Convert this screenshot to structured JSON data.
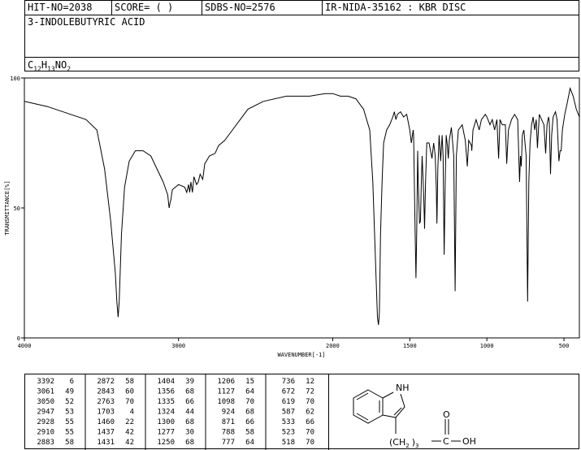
{
  "header": {
    "hit_no": "HIT-NO=2038",
    "score": "SCORE=  (  )",
    "sdbs_no": "SDBS-NO=2576",
    "ir_nida": "IR-NIDA-35162 : KBR DISC",
    "compound_name": "3-INDOLEBUTYRIC ACID",
    "formula_parts": [
      "C",
      "12",
      "H",
      "13",
      "NO",
      "2"
    ]
  },
  "chart_data": {
    "type": "line",
    "xlabel": "WAVENUMBER[-1]",
    "ylabel": "TRANSMITTANCE[%]",
    "xlim": [
      4000,
      400
    ],
    "ylim": [
      0,
      100
    ],
    "x_ticks": [
      4000,
      3000,
      2000,
      1500,
      1000,
      500
    ],
    "y_ticks": [
      0,
      50,
      100
    ],
    "series": [
      {
        "points": [
          [
            4000,
            91
          ],
          [
            3850,
            89
          ],
          [
            3700,
            86
          ],
          [
            3600,
            84
          ],
          [
            3530,
            80
          ],
          [
            3480,
            65
          ],
          [
            3440,
            45
          ],
          [
            3410,
            25
          ],
          [
            3400,
            14
          ],
          [
            3392,
            8
          ],
          [
            3385,
            14
          ],
          [
            3370,
            40
          ],
          [
            3350,
            58
          ],
          [
            3320,
            68
          ],
          [
            3280,
            72
          ],
          [
            3230,
            72
          ],
          [
            3180,
            70
          ],
          [
            3140,
            65
          ],
          [
            3100,
            60
          ],
          [
            3070,
            55
          ],
          [
            3061,
            50
          ],
          [
            3055,
            52
          ],
          [
            3050,
            53
          ],
          [
            3040,
            57
          ],
          [
            3020,
            58
          ],
          [
            3000,
            59
          ],
          [
            2960,
            58
          ],
          [
            2947,
            56
          ],
          [
            2935,
            59
          ],
          [
            2928,
            56
          ],
          [
            2920,
            60
          ],
          [
            2910,
            56
          ],
          [
            2900,
            62
          ],
          [
            2883,
            59
          ],
          [
            2872,
            60
          ],
          [
            2860,
            63
          ],
          [
            2843,
            61
          ],
          [
            2830,
            67
          ],
          [
            2800,
            70
          ],
          [
            2763,
            71
          ],
          [
            2740,
            74
          ],
          [
            2700,
            76
          ],
          [
            2650,
            80
          ],
          [
            2600,
            84
          ],
          [
            2550,
            88
          ],
          [
            2450,
            91
          ],
          [
            2300,
            93
          ],
          [
            2150,
            93
          ],
          [
            2050,
            94
          ],
          [
            2000,
            94
          ],
          [
            1950,
            93
          ],
          [
            1900,
            93
          ],
          [
            1850,
            92
          ],
          [
            1800,
            88
          ],
          [
            1760,
            80
          ],
          [
            1740,
            60
          ],
          [
            1720,
            25
          ],
          [
            1710,
            8
          ],
          [
            1703,
            5
          ],
          [
            1697,
            10
          ],
          [
            1690,
            40
          ],
          [
            1680,
            60
          ],
          [
            1670,
            75
          ],
          [
            1650,
            80
          ],
          [
            1630,
            82
          ],
          [
            1610,
            85
          ],
          [
            1600,
            87
          ],
          [
            1590,
            84
          ],
          [
            1580,
            86
          ],
          [
            1560,
            87
          ],
          [
            1540,
            85
          ],
          [
            1520,
            86
          ],
          [
            1500,
            80
          ],
          [
            1490,
            75
          ],
          [
            1478,
            80
          ],
          [
            1475,
            78
          ],
          [
            1465,
            40
          ],
          [
            1460,
            23
          ],
          [
            1455,
            40
          ],
          [
            1449,
            72
          ],
          [
            1445,
            60
          ],
          [
            1437,
            44
          ],
          [
            1431,
            45
          ],
          [
            1425,
            60
          ],
          [
            1420,
            70
          ],
          [
            1410,
            55
          ],
          [
            1404,
            42
          ],
          [
            1398,
            60
          ],
          [
            1390,
            75
          ],
          [
            1375,
            75
          ],
          [
            1356,
            69
          ],
          [
            1345,
            75
          ],
          [
            1335,
            70
          ],
          [
            1328,
            58
          ],
          [
            1324,
            44
          ],
          [
            1318,
            65
          ],
          [
            1310,
            78
          ],
          [
            1300,
            68
          ],
          [
            1290,
            78
          ],
          [
            1284,
            70
          ],
          [
            1277,
            32
          ],
          [
            1270,
            60
          ],
          [
            1264,
            78
          ],
          [
            1256,
            74
          ],
          [
            1250,
            69
          ],
          [
            1244,
            76
          ],
          [
            1230,
            81
          ],
          [
            1215,
            70
          ],
          [
            1206,
            18
          ],
          [
            1198,
            70
          ],
          [
            1185,
            80
          ],
          [
            1160,
            82
          ],
          [
            1140,
            76
          ],
          [
            1127,
            66
          ],
          [
            1118,
            76
          ],
          [
            1100,
            74
          ],
          [
            1098,
            72
          ],
          [
            1090,
            80
          ],
          [
            1070,
            84
          ],
          [
            1050,
            80
          ],
          [
            1035,
            84
          ],
          [
            1010,
            86
          ],
          [
            1000,
            85
          ],
          [
            980,
            82
          ],
          [
            965,
            84
          ],
          [
            950,
            80
          ],
          [
            935,
            84
          ],
          [
            924,
            69
          ],
          [
            915,
            84
          ],
          [
            900,
            82
          ],
          [
            880,
            82
          ],
          [
            871,
            67
          ],
          [
            860,
            80
          ],
          [
            840,
            84
          ],
          [
            820,
            86
          ],
          [
            800,
            84
          ],
          [
            788,
            60
          ],
          [
            782,
            70
          ],
          [
            777,
            66
          ],
          [
            770,
            78
          ],
          [
            760,
            80
          ],
          [
            745,
            70
          ],
          [
            736,
            14
          ],
          [
            728,
            60
          ],
          [
            720,
            75
          ],
          [
            710,
            82
          ],
          [
            700,
            85
          ],
          [
            690,
            80
          ],
          [
            680,
            84
          ],
          [
            672,
            73
          ],
          [
            660,
            86
          ],
          [
            645,
            84
          ],
          [
            630,
            82
          ],
          [
            619,
            71
          ],
          [
            610,
            82
          ],
          [
            600,
            85
          ],
          [
            595,
            83
          ],
          [
            587,
            63
          ],
          [
            580,
            78
          ],
          [
            570,
            85
          ],
          [
            555,
            87
          ],
          [
            545,
            84
          ],
          [
            533,
            68
          ],
          [
            525,
            72
          ],
          [
            518,
            72
          ],
          [
            510,
            80
          ],
          [
            495,
            86
          ],
          [
            480,
            90
          ],
          [
            460,
            96
          ],
          [
            440,
            93
          ],
          [
            420,
            88
          ],
          [
            400,
            85
          ]
        ]
      }
    ],
    "peaks": [
      [
        3392,
        6
      ],
      [
        3061,
        49
      ],
      [
        3050,
        52
      ],
      [
        2947,
        53
      ],
      [
        2928,
        55
      ],
      [
        2910,
        55
      ],
      [
        2883,
        58
      ],
      [
        2872,
        58
      ],
      [
        2843,
        60
      ],
      [
        2763,
        70
      ],
      [
        1703,
        4
      ],
      [
        1460,
        22
      ],
      [
        1437,
        42
      ],
      [
        1431,
        42
      ],
      [
        1404,
        39
      ],
      [
        1356,
        68
      ],
      [
        1335,
        66
      ],
      [
        1324,
        44
      ],
      [
        1300,
        68
      ],
      [
        1277,
        30
      ],
      [
        1250,
        68
      ],
      [
        1206,
        15
      ],
      [
        1127,
        64
      ],
      [
        1098,
        70
      ],
      [
        924,
        68
      ],
      [
        871,
        66
      ],
      [
        788,
        58
      ],
      [
        777,
        64
      ],
      [
        736,
        12
      ],
      [
        672,
        72
      ],
      [
        619,
        70
      ],
      [
        587,
        62
      ],
      [
        533,
        66
      ],
      [
        523,
        70
      ],
      [
        518,
        70
      ]
    ]
  },
  "structure": {
    "nh_label": "NH",
    "oxygen_label": "O",
    "chain_label": "(CH",
    "subscript_label": "2",
    "chain_close": ")",
    "subscript_count": "3",
    "carbon_label": "C",
    "oh_label": "OH"
  }
}
